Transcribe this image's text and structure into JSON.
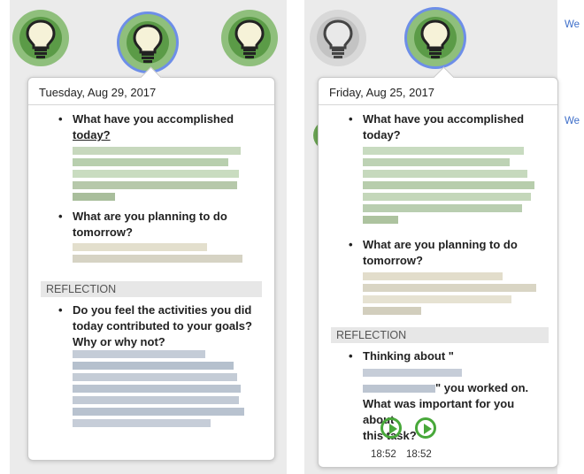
{
  "colors": {
    "bulb_green": "#5b9b47",
    "bulb_ring": "#8fbf7c",
    "selected_ring": "#6d8ee8",
    "play_green": "#48a83a",
    "link_blue": "#3d6ec9"
  },
  "left": {
    "bulbs": [
      {
        "state": "green",
        "icon": "lightbulb-icon"
      },
      {
        "state": "green-selected",
        "icon": "lightbulb-icon"
      },
      {
        "state": "green",
        "icon": "lightbulb-icon"
      }
    ],
    "date": "Tuesday, Aug 29, 2017",
    "q1": [
      "What have you accomplished",
      "today?"
    ],
    "q2": [
      "What are you planning to do",
      "tomorrow?"
    ],
    "section": "REFLECTION",
    "q3": [
      "Do you feel the activities you did",
      "today contributed to your goals?",
      "Why or why not?"
    ]
  },
  "right": {
    "bulbs": [
      {
        "state": "grey",
        "icon": "lightbulb-icon"
      },
      {
        "state": "green-selected",
        "icon": "lightbulb-icon"
      }
    ],
    "date": "Friday, Aug 25, 2017",
    "q1": [
      "What have you accomplished",
      "today?"
    ],
    "q2": [
      "What are you planning to do",
      "tomorrow?"
    ],
    "section": "REFLECTION",
    "q3": [
      "Thinking about \"",
      "\" you worked on.",
      "What was important for you about",
      "this task?"
    ],
    "audio": [
      {
        "time": "18:52",
        "icon": "play-icon"
      },
      {
        "time": "18:52",
        "icon": "play-icon"
      }
    ]
  },
  "side_links": [
    "We",
    "We"
  ]
}
